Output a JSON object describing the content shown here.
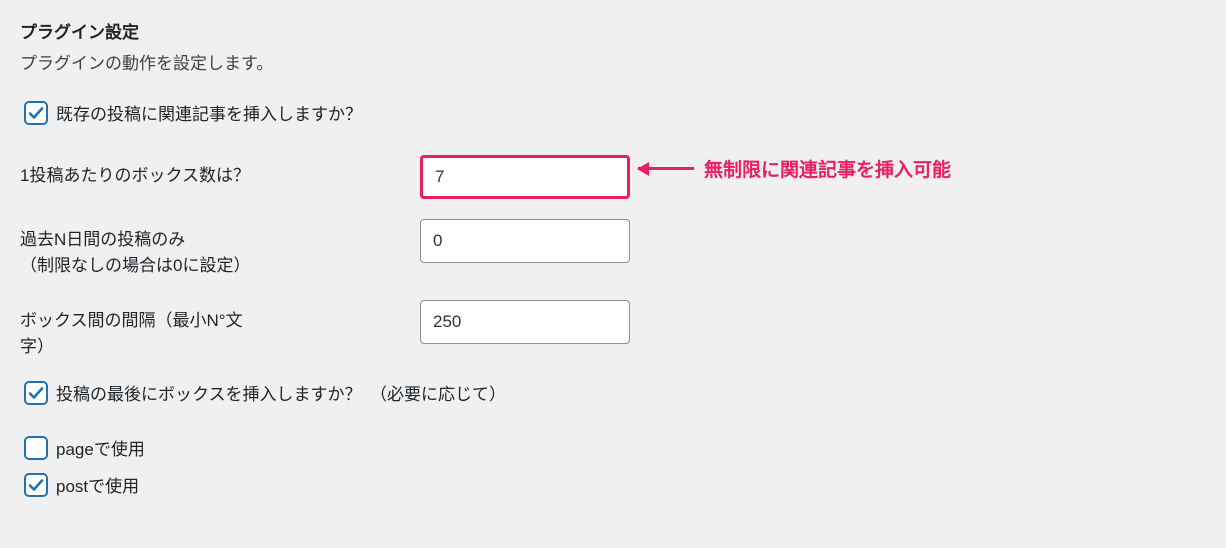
{
  "section": {
    "title": "プラグイン設定",
    "description": "プラグインの動作を設定します。"
  },
  "checkbox_insert_related": {
    "checked": true,
    "label": "既存の投稿に関連記事を挿入しますか？"
  },
  "field_boxes_per_post": {
    "label": "1投稿あたりのボックス数は？",
    "value": "7",
    "annotation": "無制限に関連記事を挿入可能"
  },
  "field_past_n_days": {
    "label_line1": "過去N日間の投稿のみ",
    "label_line2": "（制限なしの場合は0に設定）",
    "value": "0"
  },
  "field_box_spacing": {
    "label_line1": "ボックス間の間隔（最小N°文",
    "label_line2": "字）",
    "value": "250"
  },
  "checkbox_insert_at_end": {
    "checked": true,
    "label": "投稿の最後にボックスを挿入しますか？　（必要に応じて）"
  },
  "checkbox_use_in_page": {
    "checked": false,
    "label": "pageで使用"
  },
  "checkbox_use_in_post": {
    "checked": true,
    "label": "postで使用"
  }
}
